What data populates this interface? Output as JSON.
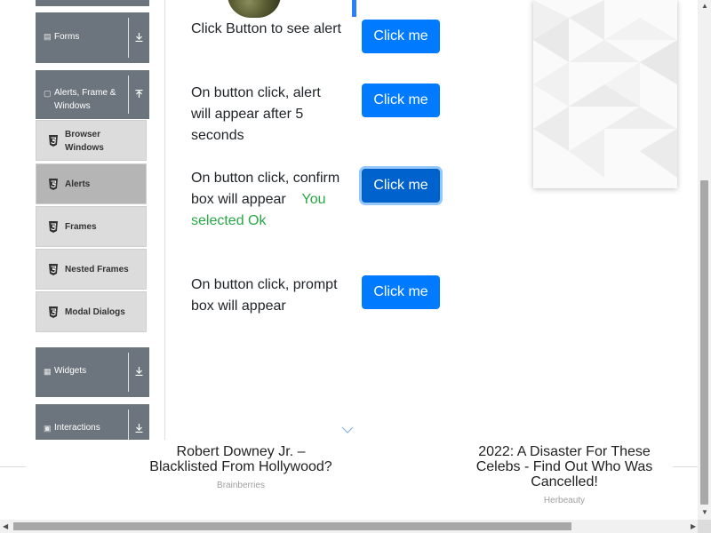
{
  "sidebar": {
    "groups": {
      "forms": {
        "label": "Forms",
        "icon": "form-icon"
      },
      "alerts": {
        "label_line1": "Alerts, Frame &",
        "label_line2": "Windows",
        "icon": "window-icon"
      },
      "widgets": {
        "label": "Widgets",
        "icon": "grid-icon"
      },
      "interactions": {
        "label": "Interactions",
        "icon": "interactions-icon"
      }
    },
    "items": [
      {
        "label_line1": "Browser",
        "label_line2": "Windows"
      },
      {
        "label_line1": "Alerts",
        "label_line2": "",
        "active": true
      },
      {
        "label_line1": "Frames",
        "label_line2": ""
      },
      {
        "label_line1": "Nested Frames",
        "label_line2": ""
      },
      {
        "label_line1": "Modal Dialogs",
        "label_line2": ""
      }
    ]
  },
  "main": {
    "rows": [
      {
        "text": "Click Button to see alert",
        "button": "Click me"
      },
      {
        "text": "On button click, alert will appear after 5 seconds",
        "button": "Click me"
      },
      {
        "text": "On button click, confirm box will appear",
        "result": "You selected Ok",
        "button": "Click me"
      },
      {
        "text": "On button click, prompt box will appear",
        "button": "Click me"
      }
    ]
  },
  "ads": [
    {
      "title_line1": "Robert Downey Jr. –",
      "title_line2": "Blacklisted From Hollywood?",
      "title_line3": "",
      "source": "Brainberries"
    },
    {
      "title_line1": "2022: A Disaster For These",
      "title_line2": "Celebs - Find Out Who Was",
      "title_line3": "Cancelled!",
      "source": "Herbeauty"
    }
  ],
  "colors": {
    "primary_button": "#007bff",
    "sidebar_group": "#6c757d",
    "result_text": "#28a745"
  }
}
